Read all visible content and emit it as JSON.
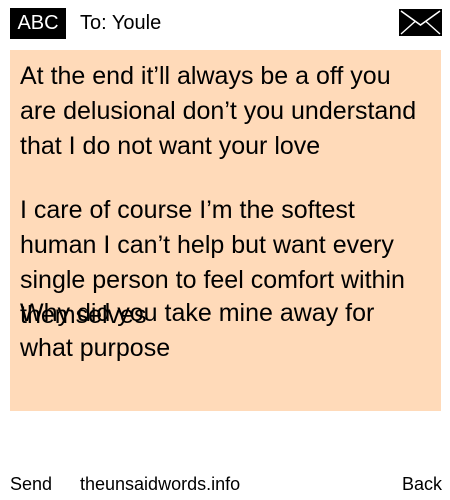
{
  "header": {
    "badge_label": "ABC",
    "to_label": "To: Youle",
    "icon": "envelope-icon"
  },
  "message": {
    "background_color": "#ffdab9",
    "paragraphs": [
      "At the end it’ll always be a off you are delusional don’t you understand that I do not want your love",
      "I care of course I’m the softest human I can’t help but want every single person to feel comfort within themselves",
      "Why did you take mine away for what purpose"
    ]
  },
  "footer": {
    "send_label": "Send",
    "site_label": "theunsaidwords.info",
    "back_label": "Back"
  }
}
